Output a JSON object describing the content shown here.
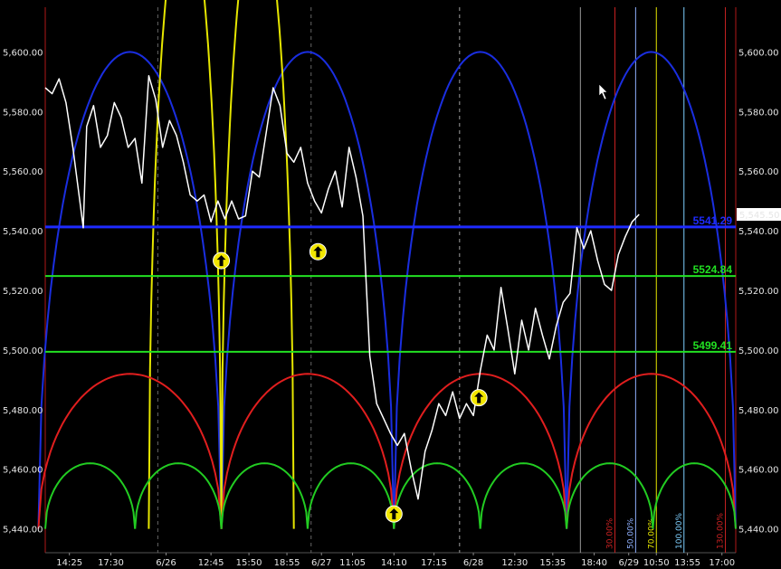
{
  "chart_data": {
    "type": "line",
    "y_axis": {
      "ticks": [
        5600,
        5580,
        5560,
        5540,
        5520,
        5500,
        5480,
        5460,
        5440
      ],
      "tick_labels": [
        "5,600.00",
        "5,580.00",
        "5,560.00",
        "5,540.00",
        "5,520.00",
        "5,500.00",
        "5,480.00",
        "5,460.00",
        "5,440.00"
      ],
      "ylim": [
        5432,
        5615
      ]
    },
    "x_axis": {
      "tick_labels": [
        "14:25",
        "17:30",
        "6/26",
        "12:45",
        "15:50",
        "18:55",
        "6/27",
        "11:05",
        "14:10",
        "17:15",
        "6/28",
        "12:30",
        "15:35",
        "18:40",
        "6/29",
        "10:50",
        "13:55",
        "17:00"
      ],
      "xlim": [
        0,
        100
      ]
    },
    "last_price_label": "5,545.50",
    "horizontal_levels": [
      {
        "label": "5541.29",
        "value": 5541.29,
        "color": "#1e2bff"
      },
      {
        "label": "5524.84",
        "value": 5524.84,
        "color": "#22e022"
      },
      {
        "label": "5499.41",
        "value": 5499.41,
        "color": "#22e022"
      }
    ],
    "vertical_pct_labels": [
      {
        "label": "30.00%",
        "color": "#cc2222"
      },
      {
        "label": "50.00%",
        "color": "#8fb0ff"
      },
      {
        "label": "70.00%",
        "color": "#e6e600"
      },
      {
        "label": "100.00%",
        "color": "#7fd0ff"
      },
      {
        "label": "130.00%",
        "color": "#cc2222"
      }
    ],
    "price_series": {
      "name": "",
      "x": [
        0,
        1,
        2,
        3,
        4,
        5,
        5.5,
        6,
        7,
        8,
        9,
        10,
        11,
        12,
        13,
        14,
        15,
        16,
        17,
        18,
        19,
        20,
        21,
        22,
        23,
        24,
        25,
        26,
        27,
        28,
        29,
        30,
        31,
        32,
        33,
        34,
        35,
        36,
        37,
        38,
        39,
        40,
        41,
        42,
        43,
        44,
        45,
        46,
        47,
        48,
        49,
        50,
        51,
        52,
        53,
        54,
        55,
        56,
        57,
        58,
        59,
        60,
        61,
        62,
        63,
        64,
        65,
        66,
        67,
        68,
        69,
        70,
        71,
        72,
        73,
        74,
        75,
        76,
        77,
        78,
        79,
        80,
        81,
        82,
        83,
        84,
        85,
        86
      ],
      "y": [
        5588,
        5586,
        5591,
        5583,
        5568,
        5550,
        5541,
        5575,
        5582,
        5568,
        5572,
        5583,
        5578,
        5568,
        5571,
        5556,
        5592,
        5584,
        5568,
        5577,
        5572,
        5563,
        5552,
        5550,
        5552,
        5543,
        5550,
        5544,
        5550,
        5544,
        5545,
        5560,
        5558,
        5573,
        5588,
        5582,
        5566,
        5563,
        5568,
        5556,
        5550,
        5546,
        5554,
        5560,
        5548,
        5568,
        5558,
        5545,
        5498,
        5482,
        5477,
        5472,
        5468,
        5472,
        5460,
        5450,
        5466,
        5473,
        5482,
        5478,
        5486,
        5477,
        5482,
        5478,
        5493,
        5505,
        5500,
        5521,
        5507,
        5492,
        5510,
        5500,
        5514,
        5505,
        5497,
        5508,
        5516,
        5519,
        5541,
        5534,
        5540,
        5530,
        5522,
        5520,
        5532,
        5538,
        5543,
        5545.5
      ]
    },
    "annotation_arrows": [
      {
        "x": 25.5,
        "y": 5530
      },
      {
        "x": 39.5,
        "y": 5533
      },
      {
        "x": 62.8,
        "y": 5484
      },
      {
        "x": 50.5,
        "y": 5445
      }
    ],
    "cycle_arcs": [
      {
        "name": "",
        "color": "#1a2ee0",
        "cusps": [
          -1,
          25.5,
          50.5,
          75.5,
          100
        ],
        "peak": 5600
      },
      {
        "name": "",
        "color": "#e6e600",
        "cusps": [
          15,
          25.5,
          36
        ],
        "peak": 5650
      },
      {
        "name": "",
        "color": "#e01e1e",
        "cusps": [
          -1,
          25.5,
          50.5,
          75.5,
          100
        ],
        "peak": 5492
      },
      {
        "name": "",
        "color": "#22cc22",
        "cusps": [
          0,
          13,
          25.5,
          38,
          50.5,
          63,
          75.5,
          88,
          100
        ],
        "peak": 5462
      }
    ]
  }
}
